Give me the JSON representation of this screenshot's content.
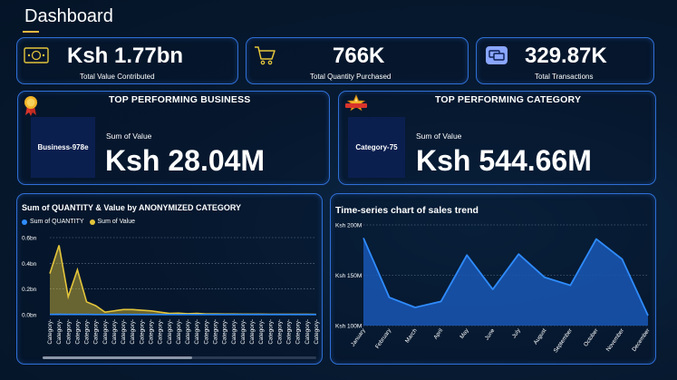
{
  "header": {
    "title": "Dashboard"
  },
  "kpis": [
    {
      "value": "Ksh 1.77bn",
      "label": "Total Value Contributed",
      "icon": "money-icon"
    },
    {
      "value": "766K",
      "label": "Total Quantity Purchased",
      "icon": "cart-icon"
    },
    {
      "value": "329.87K",
      "label": "Total Transactions",
      "icon": "transactions-icon"
    }
  ],
  "top_business": {
    "title": "TOP PERFORMING BUSINESS",
    "name": "Business-978e",
    "sum_label": "Sum of Value",
    "value": "Ksh 28.04M",
    "icon": "award-ribbon-icon"
  },
  "top_category": {
    "title": "TOP PERFORMING CATEGORY",
    "name": "Category-75",
    "sum_label": "Sum of Value",
    "value": "Ksh 544.66M",
    "icon": "star-badge-icon"
  },
  "colors": {
    "quantity": "#2f8cff",
    "value": "#e3c53b",
    "trend": "#2f8cff",
    "border": "#2f6fd6"
  },
  "chart_data": [
    {
      "type": "area",
      "title": "Sum of QUANTITY & Value by ANONYMIZED CATEGORY",
      "legend_position": "top-left",
      "series": [
        {
          "name": "Sum of QUANTITY",
          "values": [
            0.002,
            0.003,
            0.002,
            0.002,
            0.002,
            0.001,
            0.001,
            0.001,
            0.001,
            0.001,
            0.001,
            0.001,
            0.001,
            0.001,
            0.001,
            0.001,
            0.001,
            0.001,
            0.001,
            0.001,
            0.001,
            0.001,
            0.001,
            0.001,
            0.001,
            0.001,
            0.001,
            0.001,
            0.001,
            0.001
          ]
        },
        {
          "name": "Sum of Value",
          "values": [
            0.32,
            0.54,
            0.14,
            0.35,
            0.1,
            0.07,
            0.02,
            0.03,
            0.04,
            0.04,
            0.035,
            0.03,
            0.02,
            0.01,
            0.012,
            0.008,
            0.01,
            0.006,
            0.006,
            0.005,
            0.005,
            0.004,
            0.004,
            0.004,
            0.003,
            0.003,
            0.003,
            0.003,
            0.003,
            0.002
          ]
        }
      ],
      "categories": [
        "Category-",
        "Category-",
        "Category-",
        "Category-",
        "Category-",
        "Category-",
        "Category-",
        "Category-",
        "Category-",
        "Category-",
        "Category-",
        "Category-",
        "Category-",
        "Category-",
        "Category-",
        "Category-",
        "Category-",
        "Category-",
        "Category-",
        "Category-",
        "Category-",
        "Category-",
        "Category-",
        "Category-",
        "Category-",
        "Category-",
        "Category-",
        "Category-",
        "Category-",
        "Category-"
      ],
      "yticks": [
        "0.6bn",
        "0.4bn",
        "0.2bn",
        "0.0bn"
      ],
      "ylim": [
        0,
        0.6
      ],
      "grid": true
    },
    {
      "type": "area",
      "title": "Time-series chart of sales trend",
      "categories": [
        "January",
        "February",
        "March",
        "April",
        "May",
        "June",
        "July",
        "August",
        "September",
        "October",
        "November",
        "December"
      ],
      "series": [
        {
          "name": "",
          "values": [
            187,
            128,
            118,
            124,
            170,
            136,
            171,
            148,
            140,
            186,
            166,
            110
          ]
        }
      ],
      "yticks": [
        "Ksh 200M",
        "Ksh 150M",
        "Ksh 100M"
      ],
      "ylim": [
        100,
        200
      ],
      "grid": true
    }
  ]
}
